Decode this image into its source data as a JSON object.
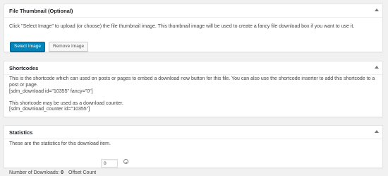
{
  "thumbnail_box": {
    "title": "File Thumbnail (Optional)",
    "description": "Click \"Select Image\" to upload (or choose) the file thumbnail image. This thumbnail image will be used to create a fancy file download box if you want to use it.",
    "select_button": "Select Image",
    "remove_button": "Remove Image"
  },
  "shortcodes_box": {
    "title": "Shortcodes",
    "description": "This is the shortcode which can used on posts or pages to embed a download now button for this file. You can also use the shortcode inserter to add this shortcode to a post or page.",
    "shortcode_main": "[sdm_download id=\"10355\" fancy=\"0\"]",
    "counter_description": "This shortcode may be used as a download counter.",
    "shortcode_counter": "[sdm_download_counter id=\"10355\"]"
  },
  "statistics_box": {
    "title": "Statistics",
    "description": "These are the statistics for this download item.",
    "downloads_label": "Number of Downloads:",
    "downloads_value": "0",
    "offset_label": "Offset Count",
    "offset_value": "0"
  },
  "icons": {
    "toggle": "triangle-up-icon",
    "add": "plus-circle-icon"
  },
  "colors": {
    "primary_button": "#0085ba",
    "background": "#f1f1f1"
  }
}
